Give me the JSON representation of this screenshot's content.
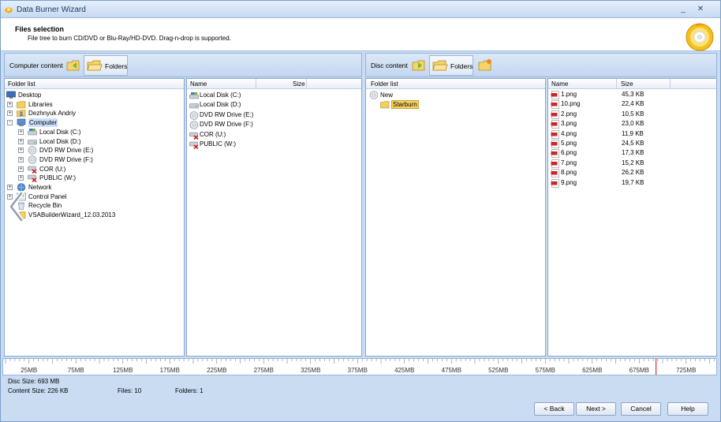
{
  "window": {
    "title": "Data Burner Wizard",
    "minimize": "_",
    "close": "✕"
  },
  "header": {
    "title": "Files selection",
    "subtitle": "File tree to burn CD/DVD or Blu-Ray/HD-DVD. Drag-n-drop is supported."
  },
  "left_toolbar": {
    "label": "Computer content",
    "folders_label": "Folders"
  },
  "right_toolbar": {
    "label": "Disc content",
    "folders_label": "Folders"
  },
  "left_tree": {
    "header": "Folder list",
    "items": [
      {
        "label": "Desktop",
        "icon": "desktop-icon"
      },
      {
        "label": "Libraries",
        "icon": "folder-icon"
      },
      {
        "label": "Dezhnyuk Andriy",
        "icon": "user-folder-icon"
      },
      {
        "label": "Computer",
        "icon": "computer-icon"
      },
      {
        "label": "Local Disk (C:)",
        "icon": "disk-c-icon"
      },
      {
        "label": "Local Disk (D:)",
        "icon": "disk-icon"
      },
      {
        "label": "DVD RW Drive (E:)",
        "icon": "dvd-drive-icon"
      },
      {
        "label": "DVD RW Drive (F:)",
        "icon": "dvd-drive-icon"
      },
      {
        "label": "COR (U:)",
        "icon": "network-drive-disconnected-icon"
      },
      {
        "label": "PUBLIC (W:)",
        "icon": "network-drive-disconnected-icon"
      },
      {
        "label": "Network",
        "icon": "network-icon"
      },
      {
        "label": "Control Panel",
        "icon": "control-panel-icon"
      },
      {
        "label": "Recycle Bin",
        "icon": "recycle-bin-icon"
      },
      {
        "label": "VSABuilderWizard_12.03.2013",
        "icon": "folder-icon"
      }
    ]
  },
  "left_list": {
    "headers": {
      "name": "Name",
      "size": "Size"
    },
    "items": [
      {
        "name": "Local Disk (C:)",
        "icon": "disk-c-icon"
      },
      {
        "name": "Local Disk (D:)",
        "icon": "disk-icon"
      },
      {
        "name": "DVD RW Drive (E:)",
        "icon": "dvd-drive-icon"
      },
      {
        "name": "DVD RW Drive (F:)",
        "icon": "dvd-drive-icon"
      },
      {
        "name": "COR (U:)",
        "icon": "network-drive-disconnected-icon"
      },
      {
        "name": "PUBLIC (W:)",
        "icon": "network-drive-disconnected-icon"
      }
    ]
  },
  "right_tree": {
    "header": "Folder list",
    "items": [
      {
        "label": "New",
        "icon": "disc-icon"
      },
      {
        "label": "Starburn",
        "icon": "folder-icon"
      }
    ]
  },
  "right_list": {
    "headers": {
      "name": "Name",
      "size": "Size"
    },
    "items": [
      {
        "name": "1.png",
        "size": "45,3 KB"
      },
      {
        "name": "10.png",
        "size": "22,4 KB"
      },
      {
        "name": "2.png",
        "size": "10,5 KB"
      },
      {
        "name": "3.png",
        "size": "23,0 KB"
      },
      {
        "name": "4.png",
        "size": "11,9 KB"
      },
      {
        "name": "5.png",
        "size": "24,5 KB"
      },
      {
        "name": "6.png",
        "size": "17,3 KB"
      },
      {
        "name": "7.png",
        "size": "15,2 KB"
      },
      {
        "name": "8.png",
        "size": "26,2 KB"
      },
      {
        "name": "9.png",
        "size": "19,7 KB"
      }
    ]
  },
  "ruler": {
    "ticks": [
      "25MB",
      "75MB",
      "125MB",
      "175MB",
      "225MB",
      "275MB",
      "325MB",
      "375MB",
      "425MB",
      "475MB",
      "525MB",
      "575MB",
      "625MB",
      "675MB",
      "725MB"
    ],
    "capacity_mb": 693,
    "marker_color": "#d01010"
  },
  "status": {
    "disc_size": "Disc Size: 693 MB",
    "content_size": "Content Size: 226 KB",
    "files": "Files: 10",
    "folders": "Folders: 1"
  },
  "buttons": {
    "back": "< Back",
    "next": "Next >",
    "cancel": "Cancel",
    "help": "Help"
  },
  "colors": {
    "accent": "#c9dcf2",
    "selection": "#cbe0fb",
    "highlight": "#f8d263"
  }
}
